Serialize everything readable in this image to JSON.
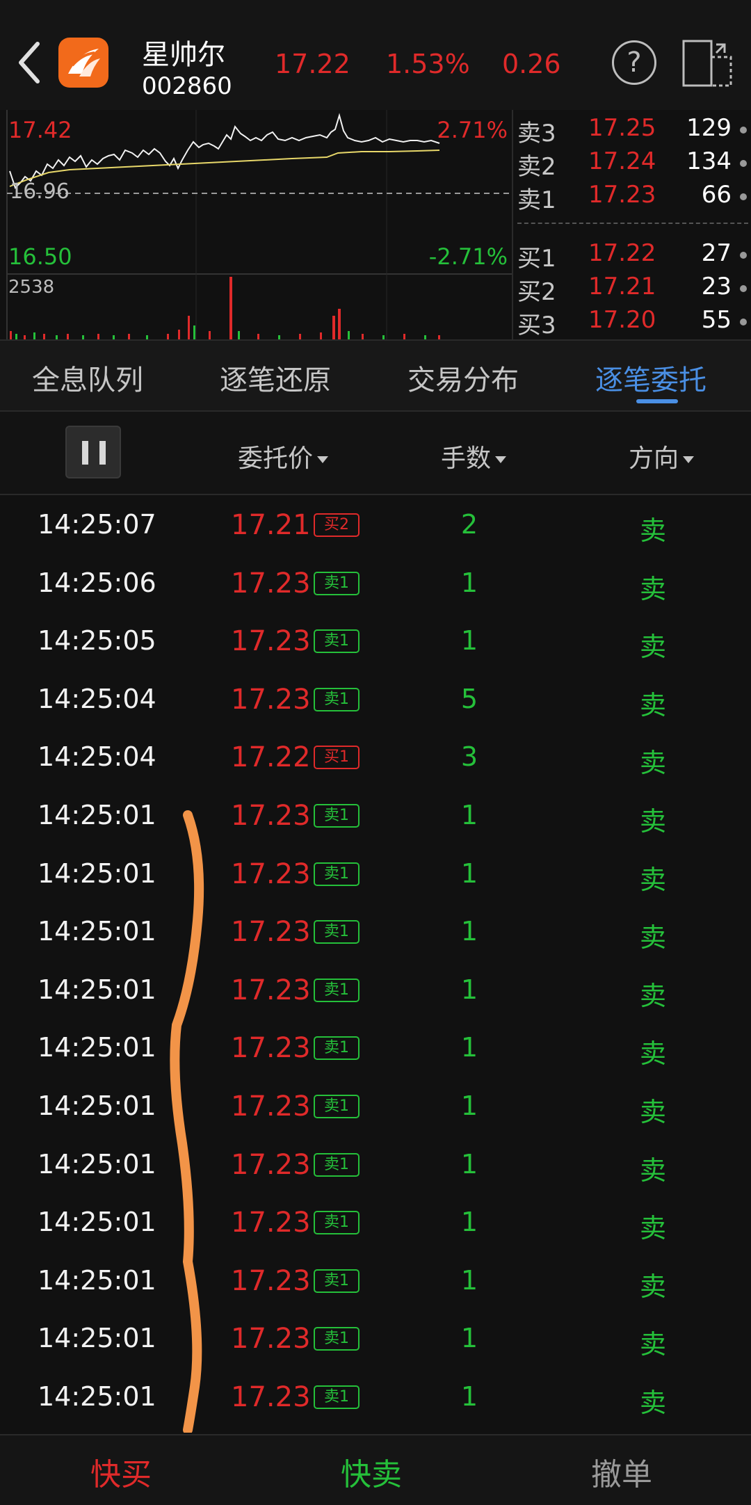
{
  "header": {
    "name": "星帅尔",
    "code": "002860",
    "price": "17.22",
    "change_pct": "1.53%",
    "change": "0.26"
  },
  "chart": {
    "high_price": "17.42",
    "high_pct": "2.71%",
    "mid_price": "16.96",
    "low_price": "16.50",
    "low_pct": "-2.71%",
    "volume_max": "2538"
  },
  "order_book": {
    "asks": [
      {
        "label": "卖3",
        "price": "17.25",
        "volume": "129"
      },
      {
        "label": "卖2",
        "price": "17.24",
        "volume": "134"
      },
      {
        "label": "卖1",
        "price": "17.23",
        "volume": "66"
      }
    ],
    "bids": [
      {
        "label": "买1",
        "price": "17.22",
        "volume": "27"
      },
      {
        "label": "买2",
        "price": "17.21",
        "volume": "23"
      },
      {
        "label": "买3",
        "price": "17.20",
        "volume": "55"
      }
    ]
  },
  "tabs": [
    "全息队列",
    "逐笔还原",
    "交易分布",
    "逐笔委托"
  ],
  "columns": {
    "price": "委托价",
    "lots": "手数",
    "direction": "方向"
  },
  "orders": [
    {
      "time": "14:25:07",
      "price": "17.21",
      "tag": "买2",
      "lots": "2",
      "dir": "卖"
    },
    {
      "time": "14:25:06",
      "price": "17.23",
      "tag": "卖1",
      "lots": "1",
      "dir": "卖"
    },
    {
      "time": "14:25:05",
      "price": "17.23",
      "tag": "卖1",
      "lots": "1",
      "dir": "卖"
    },
    {
      "time": "14:25:04",
      "price": "17.23",
      "tag": "卖1",
      "lots": "5",
      "dir": "卖"
    },
    {
      "time": "14:25:04",
      "price": "17.22",
      "tag": "买1",
      "lots": "3",
      "dir": "卖"
    },
    {
      "time": "14:25:01",
      "price": "17.23",
      "tag": "卖1",
      "lots": "1",
      "dir": "卖"
    },
    {
      "time": "14:25:01",
      "price": "17.23",
      "tag": "卖1",
      "lots": "1",
      "dir": "卖"
    },
    {
      "time": "14:25:01",
      "price": "17.23",
      "tag": "卖1",
      "lots": "1",
      "dir": "卖"
    },
    {
      "time": "14:25:01",
      "price": "17.23",
      "tag": "卖1",
      "lots": "1",
      "dir": "卖"
    },
    {
      "time": "14:25:01",
      "price": "17.23",
      "tag": "卖1",
      "lots": "1",
      "dir": "卖"
    },
    {
      "time": "14:25:01",
      "price": "17.23",
      "tag": "卖1",
      "lots": "1",
      "dir": "卖"
    },
    {
      "time": "14:25:01",
      "price": "17.23",
      "tag": "卖1",
      "lots": "1",
      "dir": "卖"
    },
    {
      "time": "14:25:01",
      "price": "17.23",
      "tag": "卖1",
      "lots": "1",
      "dir": "卖"
    },
    {
      "time": "14:25:01",
      "price": "17.23",
      "tag": "卖1",
      "lots": "1",
      "dir": "卖"
    },
    {
      "time": "14:25:01",
      "price": "17.23",
      "tag": "卖1",
      "lots": "1",
      "dir": "卖"
    },
    {
      "time": "14:25:01",
      "price": "17.23",
      "tag": "卖1",
      "lots": "1",
      "dir": "卖"
    }
  ],
  "bottom": {
    "buy": "快买",
    "sell": "快卖",
    "cancel": "撤单"
  },
  "colors": {
    "up": "#e02a2a",
    "down": "#25c03a",
    "accent": "#4a8fe4",
    "annotation": "#f29448"
  }
}
